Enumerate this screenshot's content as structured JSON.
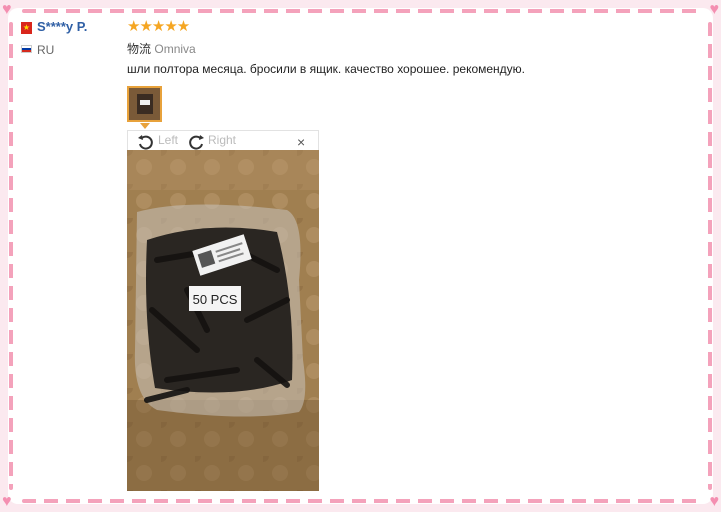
{
  "review": {
    "user_name": "S****y P.",
    "country": "RU",
    "rating_stars": "★★★★★",
    "rating_value": 5,
    "logistics_label": "物流",
    "logistics_value": "Omniva",
    "text": "шли полтора месяца. бросили в ящик. качество хорошее. рекомендую."
  },
  "viewer": {
    "rotate_left_label": "Left",
    "rotate_right_label": "Right",
    "close_glyph": "×"
  },
  "photo": {
    "label_text": "50 PCS"
  },
  "colors": {
    "frame_dash": "#f4a2bb",
    "name_link": "#2f5fa5",
    "star": "#f5a623",
    "thumb_border": "#e8a23b"
  }
}
